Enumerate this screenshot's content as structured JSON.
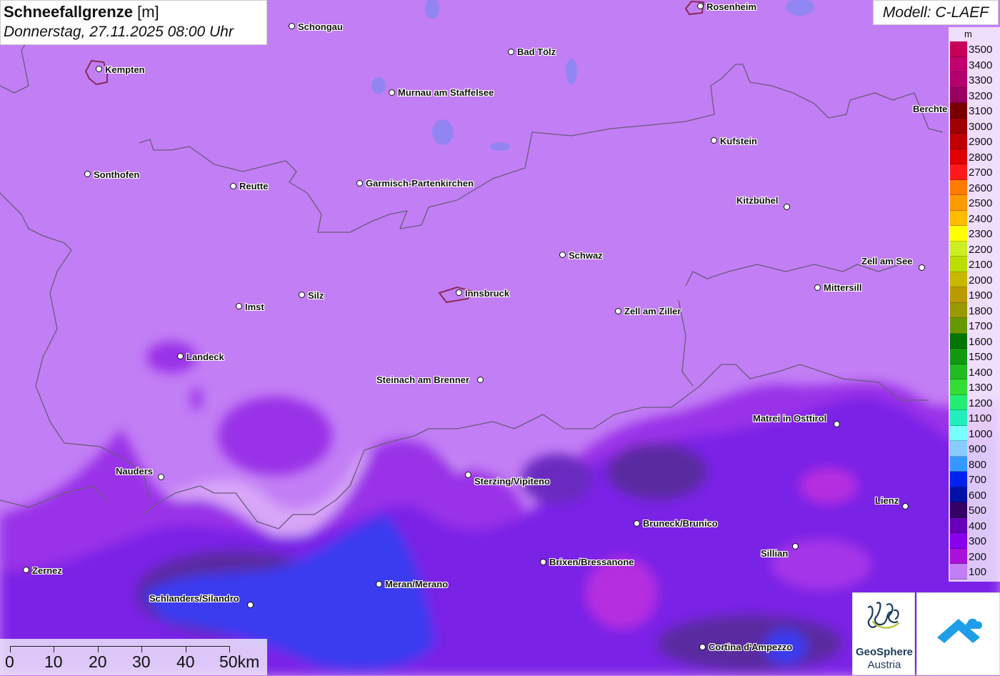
{
  "header": {
    "title": "Schneefallgrenze",
    "unit": "[m]",
    "date": "Donnerstag, 27.11.2025 08:00 Uhr"
  },
  "model_label": "Modell: C-LAEF",
  "legend": {
    "unit": "m",
    "entries": [
      {
        "value": "3500",
        "color": "#c8005a"
      },
      {
        "value": "3400",
        "color": "#c3006e"
      },
      {
        "value": "3300",
        "color": "#b3006e"
      },
      {
        "value": "3200",
        "color": "#9a0060"
      },
      {
        "value": "3100",
        "color": "#7a0000"
      },
      {
        "value": "3000",
        "color": "#a00000"
      },
      {
        "value": "2900",
        "color": "#c00000"
      },
      {
        "value": "2800",
        "color": "#e00000"
      },
      {
        "value": "2700",
        "color": "#ff1a1a"
      },
      {
        "value": "2600",
        "color": "#ff7a00"
      },
      {
        "value": "2500",
        "color": "#ff9900"
      },
      {
        "value": "2400",
        "color": "#ffbb00"
      },
      {
        "value": "2300",
        "color": "#ffff00"
      },
      {
        "value": "2200",
        "color": "#ccee22"
      },
      {
        "value": "2100",
        "color": "#bbdd00"
      },
      {
        "value": "2000",
        "color": "#c8b800"
      },
      {
        "value": "1900",
        "color": "#bb9900"
      },
      {
        "value": "1800",
        "color": "#999900"
      },
      {
        "value": "1700",
        "color": "#669900"
      },
      {
        "value": "1600",
        "color": "#007700"
      },
      {
        "value": "1500",
        "color": "#119911"
      },
      {
        "value": "1400",
        "color": "#22bb22"
      },
      {
        "value": "1300",
        "color": "#33dd33"
      },
      {
        "value": "1200",
        "color": "#22ee77"
      },
      {
        "value": "1100",
        "color": "#22eebb"
      },
      {
        "value": "1000",
        "color": "#77ffff"
      },
      {
        "value": "900",
        "color": "#88ccff"
      },
      {
        "value": "800",
        "color": "#3399ff"
      },
      {
        "value": "700",
        "color": "#0022ee"
      },
      {
        "value": "600",
        "color": "#0011aa"
      },
      {
        "value": "500",
        "color": "#330066"
      },
      {
        "value": "400",
        "color": "#6600bb"
      },
      {
        "value": "300",
        "color": "#8800ee"
      },
      {
        "value": "200",
        "color": "#aa11dd"
      },
      {
        "value": "100",
        "color": "#c27ef5"
      }
    ]
  },
  "cities": [
    {
      "name": "Schongau"
    },
    {
      "name": "Rosenheim"
    },
    {
      "name": "Kempten"
    },
    {
      "name": "Bad Tölz"
    },
    {
      "name": "Murnau am Staffelsee"
    },
    {
      "name": "Berchte"
    },
    {
      "name": "Kufstein"
    },
    {
      "name": "Sonthofen"
    },
    {
      "name": "Reutte"
    },
    {
      "name": "Garmisch-Partenkirchen"
    },
    {
      "name": "Kitzbühel"
    },
    {
      "name": "Schwaz"
    },
    {
      "name": "Zell am See"
    },
    {
      "name": "Mittersill"
    },
    {
      "name": "Innsbruck"
    },
    {
      "name": "Silz"
    },
    {
      "name": "Imst"
    },
    {
      "name": "Zell am Ziller"
    },
    {
      "name": "Landeck"
    },
    {
      "name": "Steinach am Brenner"
    },
    {
      "name": "Matrei in Osttirol"
    },
    {
      "name": "Nauders"
    },
    {
      "name": "Sterzing/Vipiteno"
    },
    {
      "name": "Lienz"
    },
    {
      "name": "Bruneck/Brunico"
    },
    {
      "name": "Sillian"
    },
    {
      "name": "Brixen/Bressanone"
    },
    {
      "name": "Zernez"
    },
    {
      "name": "Meran/Merano"
    },
    {
      "name": "Schlanders/Silandro"
    },
    {
      "name": "Cortina d'Ampezzo"
    }
  ],
  "scale_bar": {
    "labels": [
      "0",
      "10",
      "20",
      "30",
      "40",
      "50km"
    ]
  },
  "logos": {
    "geosphere_name": "GeoSphere",
    "geosphere_sub": "Austria"
  },
  "colors": {
    "base": "#c27ef5",
    "lavender": "#d8a6f8",
    "violet": "#9a30e8",
    "purple": "#7a22e6",
    "deep_purple": "#5a2aa0",
    "blue": "#3a3af0",
    "magenta": "#b52ee0"
  }
}
